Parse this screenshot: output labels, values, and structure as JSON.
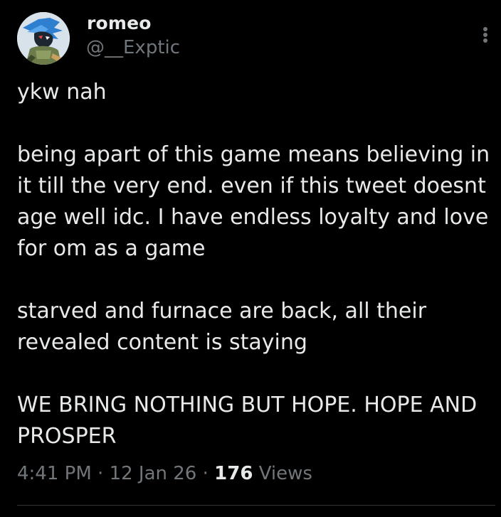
{
  "author": {
    "display_name": "romeo",
    "handle": "@__Exptic"
  },
  "tweet": {
    "paragraphs": [
      "ykw nah",
      "being apart of this game means believing in it till the very end. even if this tweet doesnt age well idc. I have endless loyalty and love for om as a game",
      "starved and furnace are back, all their revealed content is staying",
      "WE BRING NOTHING BUT HOPE. HOPE AND PROSPER"
    ],
    "time": "4:41 PM",
    "date": "12 Jan 26",
    "separator": "·",
    "views_count": "176",
    "views_label": "Views"
  },
  "icons": {
    "more": "more-vertical-icon",
    "avatar": "avatar-image"
  },
  "colors": {
    "background": "#000000",
    "primary_text": "#e7e9ea",
    "secondary_text": "#71767b",
    "divider": "#2f3336"
  }
}
